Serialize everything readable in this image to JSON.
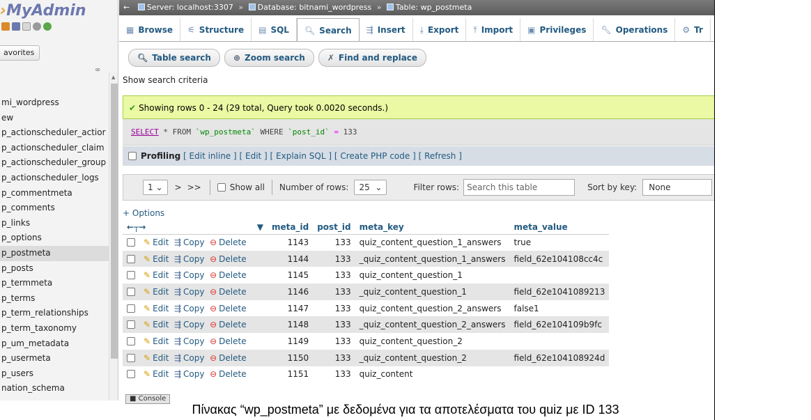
{
  "app": {
    "logo_left": "MyAdmin"
  },
  "nav": {
    "favorites_label": "avorites",
    "tables": [
      "mi_wordpress",
      "ew",
      "p_actionscheduler_actior",
      "p_actionscheduler_claim",
      "p_actionscheduler_group",
      "p_actionscheduler_logs",
      "p_commentmeta",
      "p_comments",
      "p_links",
      "p_options",
      "p_postmeta",
      "p_posts",
      "p_termmeta",
      "p_terms",
      "p_term_relationships",
      "p_term_taxonomy",
      "p_um_metadata",
      "p_usermeta",
      "p_users",
      "nation_schema"
    ]
  },
  "breadcrumb": {
    "server": "Server: localhost:3307",
    "database": "Database: bitnami_wordpress",
    "table": "Table: wp_postmeta"
  },
  "tabs": [
    "Browse",
    "Structure",
    "SQL",
    "Search",
    "Insert",
    "Export",
    "Import",
    "Privileges",
    "Operations",
    "Tr"
  ],
  "subtabs": [
    "Table search",
    "Zoom search",
    "Find and replace"
  ],
  "show_criteria": "Show search criteria",
  "success_message": "Showing rows 0 - 24 (29 total, Query took 0.0020 seconds.)",
  "sql": {
    "select": "SELECT",
    "rest1": " * FROM ",
    "table": "`wp_postmeta`",
    "where": " WHERE ",
    "col": "`post_id`",
    "op": " = ",
    "val": "133"
  },
  "profiling": {
    "label": "Profiling",
    "links": "[ Edit inline ] [ Edit ] [ Explain SQL ] [ Create PHP code ] [ Refresh ]"
  },
  "navbar": {
    "page": "1",
    "next": ">",
    "last": ">>",
    "show_all": "Show all",
    "num_rows_label": "Number of rows:",
    "num_rows": "25",
    "filter_label": "Filter rows:",
    "filter_placeholder": "Search this table",
    "sort_label": "Sort by key:",
    "sort_value": "None"
  },
  "options_label": "+ Options",
  "table": {
    "columns": [
      "meta_id",
      "post_id",
      "meta_key",
      "meta_value"
    ],
    "actions": {
      "edit": "Edit",
      "copy": "Copy",
      "delete": "Delete"
    },
    "rows": [
      {
        "meta_id": "1143",
        "post_id": "133",
        "meta_key": "quiz_content_question_1_answers",
        "meta_value": "true"
      },
      {
        "meta_id": "1144",
        "post_id": "133",
        "meta_key": "_quiz_content_question_1_answers",
        "meta_value": "field_62e104108cc4c"
      },
      {
        "meta_id": "1145",
        "post_id": "133",
        "meta_key": "quiz_content_question_1",
        "meta_value": ""
      },
      {
        "meta_id": "1146",
        "post_id": "133",
        "meta_key": "_quiz_content_question_1",
        "meta_value": "field_62e1041089213"
      },
      {
        "meta_id": "1147",
        "post_id": "133",
        "meta_key": "quiz_content_question_2_answers",
        "meta_value": "false1"
      },
      {
        "meta_id": "1148",
        "post_id": "133",
        "meta_key": "_quiz_content_question_2_answers",
        "meta_value": "field_62e104109b9fc"
      },
      {
        "meta_id": "1149",
        "post_id": "133",
        "meta_key": "quiz_content_question_2",
        "meta_value": ""
      },
      {
        "meta_id": "1150",
        "post_id": "133",
        "meta_key": "_quiz_content_question_2",
        "meta_value": "field_62e104108924d"
      },
      {
        "meta_id": "1151",
        "post_id": "133",
        "meta_key": "quiz_content",
        "meta_value": ""
      }
    ]
  },
  "console_label": "Console",
  "caption": "Πίνακας “wp_postmeta” με δεδομένα για τα αποτελέσματα του quiz με ID 133"
}
